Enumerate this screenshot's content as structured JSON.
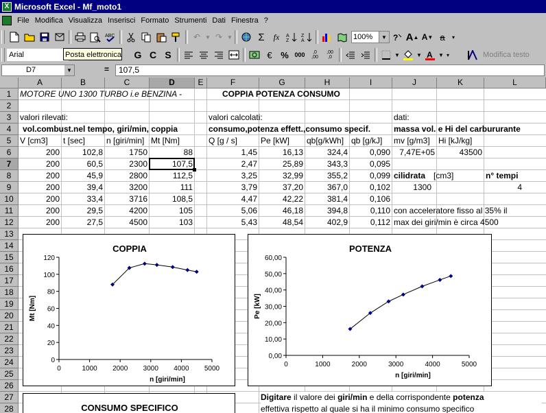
{
  "window": {
    "title": "Microsoft Excel - Mf_moto1"
  },
  "menu": [
    "File",
    "Modifica",
    "Visualizza",
    "Inserisci",
    "Formato",
    "Strumenti",
    "Dati",
    "Finestra",
    "?"
  ],
  "toolbar": {
    "zoom": "100%",
    "font_name": "Arial",
    "tooltip": "Posta elettronica",
    "bold": "G",
    "italic": "C",
    "underline": "S",
    "euro": "€",
    "percent": "%",
    "thousands": "000",
    "decimals_add": ",0\n,00",
    "decimals_remove": ",00\n,0",
    "sigma": "Σ",
    "fx": "fx",
    "modifica_testo": "Modifica testo"
  },
  "formula_bar": {
    "name_box": "D7",
    "equals": "=",
    "value": "107,5"
  },
  "columns": [
    "A",
    "B",
    "C",
    "D",
    "E",
    "F",
    "G",
    "H",
    "I",
    "J",
    "K",
    "L"
  ],
  "rows": [
    "1",
    "2",
    "3",
    "4",
    "5",
    "6",
    "7",
    "8",
    "9",
    "10",
    "11",
    "12",
    "13",
    "14",
    "15",
    "16",
    "17",
    "18",
    "19",
    "20",
    "21",
    "22",
    "23",
    "24",
    "25",
    "26",
    "27",
    "28"
  ],
  "cells": {
    "r1_a": "MOTORE    UNO 1300 TURBO  i.e  BENZINA   -",
    "r1_f": "COPPIA POTENZA CONSUMO",
    "r3_a": "valori rilevati:",
    "r3_f": "valori calcolati:",
    "r3_j": "dati:",
    "r4_a": "vol.combust.nel tempo, giri/min, coppia",
    "r4_f": "consumo,potenza effett.,consumo specif.",
    "r4_j": "massa vol. e Hi del carbururante",
    "r5": [
      "V [cm3]",
      "t [sec]",
      "n [giri/min]",
      "Mt [Nm]",
      "Q [g / s]",
      "Pe [kW]",
      "qb[g/kWh]",
      "qb [g/kJ]",
      "mv [g/m3]",
      "Hi [kJ/kg]"
    ],
    "r6_j": "7,47E+05",
    "r6_k": "43500",
    "r8_j": "cilidrata",
    "r8_j2": "[cm3]",
    "r8_l": "n° tempi",
    "r9_j": "1300",
    "r9_l": "4",
    "r11_j": "con acceleratore fisso al 35% il",
    "r12_j": "max dei giri/min è circa  4500"
  },
  "table": [
    [
      "200",
      "102,8",
      "1750",
      "88",
      "1,45",
      "16,13",
      "324,4",
      "0,090"
    ],
    [
      "200",
      "60,5",
      "2300",
      "107,5",
      "2,47",
      "25,89",
      "343,3",
      "0,095"
    ],
    [
      "200",
      "45,9",
      "2800",
      "112,5",
      "3,25",
      "32,99",
      "355,2",
      "0,099"
    ],
    [
      "200",
      "39,4",
      "3200",
      "111",
      "3,79",
      "37,20",
      "367,0",
      "0,102"
    ],
    [
      "200",
      "33,4",
      "3716",
      "108,5",
      "4,47",
      "42,22",
      "381,4",
      "0,106"
    ],
    [
      "200",
      "29,5",
      "4200",
      "105",
      "5,06",
      "46,18",
      "394,8",
      "0,110"
    ],
    [
      "200",
      "27,5",
      "4500",
      "103",
      "5,43",
      "48,54",
      "402,9",
      "0,112"
    ]
  ],
  "notes": {
    "line1_a": "Digitare",
    "line1_b": " il valore dei ",
    "line1_c": "giri/min",
    "line1_d": " e della corrispondente ",
    "line1_e": "potenza",
    "line2": "effettiva rispetto al quale si ha il minimo consumo specifico"
  },
  "chart_data": [
    {
      "type": "line",
      "title": "COPPIA",
      "xlabel": "n [giri/min]",
      "ylabel": "Mt [Nm]",
      "x": [
        1750,
        2300,
        2800,
        3200,
        3716,
        4200,
        4500
      ],
      "values": [
        88,
        107.5,
        112.5,
        111,
        108.5,
        105,
        103
      ],
      "xlim": [
        0,
        5000
      ],
      "ylim": [
        0,
        120
      ],
      "xticks": [
        "0",
        "1000",
        "2000",
        "3000",
        "4000",
        "5000"
      ],
      "yticks": [
        "0",
        "20",
        "40",
        "60",
        "80",
        "100",
        "120"
      ],
      "marker_color": "#000080",
      "line_color": "#000000"
    },
    {
      "type": "line",
      "title": "POTENZA",
      "xlabel": "n [giri/min]",
      "ylabel": "Pe [kW]",
      "x": [
        1750,
        2300,
        2800,
        3200,
        3716,
        4200,
        4500
      ],
      "values": [
        16.13,
        25.89,
        32.99,
        37.2,
        42.22,
        46.18,
        48.54
      ],
      "xlim": [
        0,
        5000
      ],
      "ylim": [
        0,
        60
      ],
      "xticks": [
        "0",
        "1000",
        "2000",
        "3000",
        "4000",
        "5000"
      ],
      "yticks": [
        "0,00",
        "10,00",
        "20,00",
        "30,00",
        "40,00",
        "50,00",
        "60,00"
      ],
      "marker_color": "#000080",
      "line_color": "#000000"
    },
    {
      "type": "line",
      "title": "CONSUMO SPECIFICO"
    }
  ]
}
